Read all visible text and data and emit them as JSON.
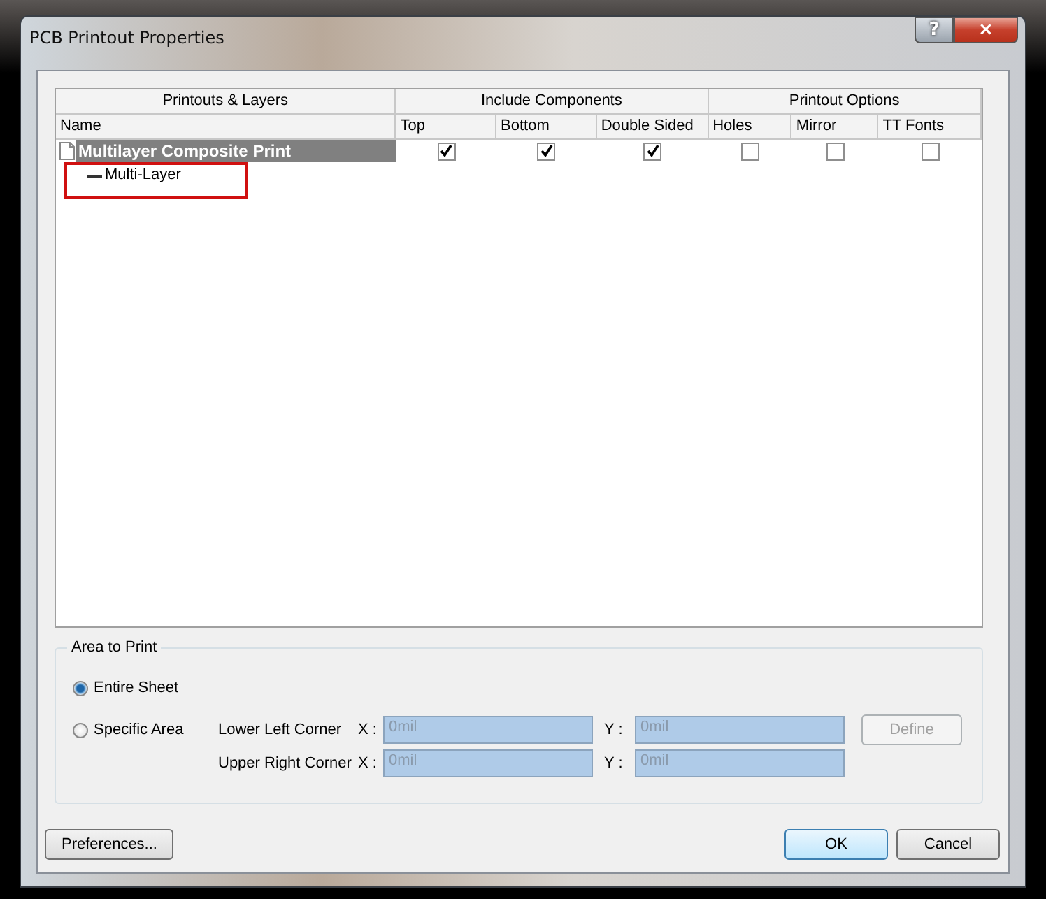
{
  "window": {
    "title": "PCB Printout Properties",
    "help": "?",
    "close": "×"
  },
  "table": {
    "groups": [
      {
        "label": "Printouts & Layers",
        "columns": [
          "Name"
        ]
      },
      {
        "label": "Include Components",
        "columns": [
          "Top",
          "Bottom",
          "Double Sided"
        ]
      },
      {
        "label": "Printout Options",
        "columns": [
          "Holes",
          "Mirror",
          "TT Fonts"
        ]
      }
    ],
    "rows": [
      {
        "name": "Multilayer Composite Print",
        "selected": true,
        "checks": [
          true,
          true,
          true,
          false,
          false,
          false
        ],
        "children": [
          {
            "name": "Multi-Layer",
            "highlighted": true
          }
        ]
      }
    ]
  },
  "area": {
    "title": "Area to Print",
    "options": [
      {
        "label": "Entire Sheet",
        "selected": true
      },
      {
        "label": "Specific Area",
        "selected": false
      }
    ],
    "corners": [
      {
        "label": "Lower Left Corner",
        "x_label": "X :",
        "x": "0mil",
        "y_label": "Y :",
        "y": "0mil"
      },
      {
        "label": "Upper Right Corner",
        "x_label": "X :",
        "x": "0mil",
        "y_label": "Y :",
        "y": "0mil"
      }
    ],
    "define": {
      "label": "Define",
      "disabled": true
    }
  },
  "buttons": [
    {
      "label": "Preferences...",
      "default": false
    },
    {
      "label": "OK",
      "default": true
    },
    {
      "label": "Cancel",
      "default": false
    }
  ]
}
